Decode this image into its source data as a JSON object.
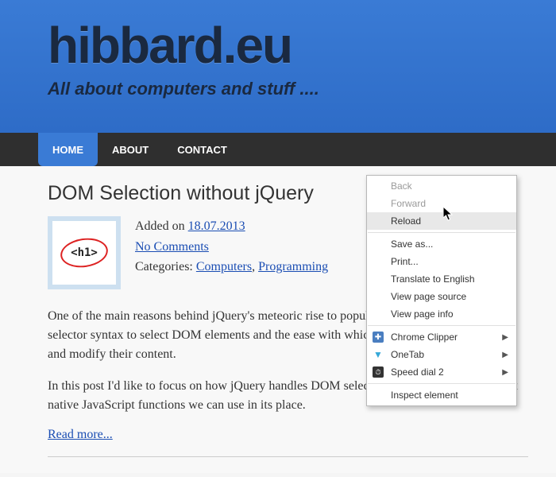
{
  "header": {
    "title": "hibbard.eu",
    "tagline": "All about computers and stuff ...."
  },
  "nav": {
    "items": [
      {
        "label": "HOME",
        "active": true
      },
      {
        "label": "ABOUT",
        "active": false
      },
      {
        "label": "CONTACT",
        "active": false
      }
    ]
  },
  "post": {
    "title": "DOM Selection without jQuery",
    "thumb_text": "<h1>",
    "meta": {
      "added_prefix": "Added on ",
      "date": "18.07.2013",
      "comments": "No Comments",
      "categories_prefix": "Categories: ",
      "cat1": "Computers",
      "cat_sep": ", ",
      "cat2": "Programming"
    },
    "para1": "One of the main reasons behind jQuery's meteoric rise to popularity was its use of the CSS selector syntax to select DOM elements and the ease with which it could then traverse these and modify their content.",
    "para2": "In this post I'd like to focus on how jQuery handles DOM selection under the hood and what native JavaScript functions we can use in its place.",
    "read_more": "Read more..."
  },
  "context_menu": {
    "back": "Back",
    "forward": "Forward",
    "reload": "Reload",
    "save_as": "Save as...",
    "print": "Print...",
    "translate": "Translate to English",
    "view_source": "View page source",
    "view_info": "View page info",
    "clipper": "Chrome Clipper",
    "onetab": "OneTab",
    "speed": "Speed dial 2",
    "inspect": "Inspect element"
  }
}
